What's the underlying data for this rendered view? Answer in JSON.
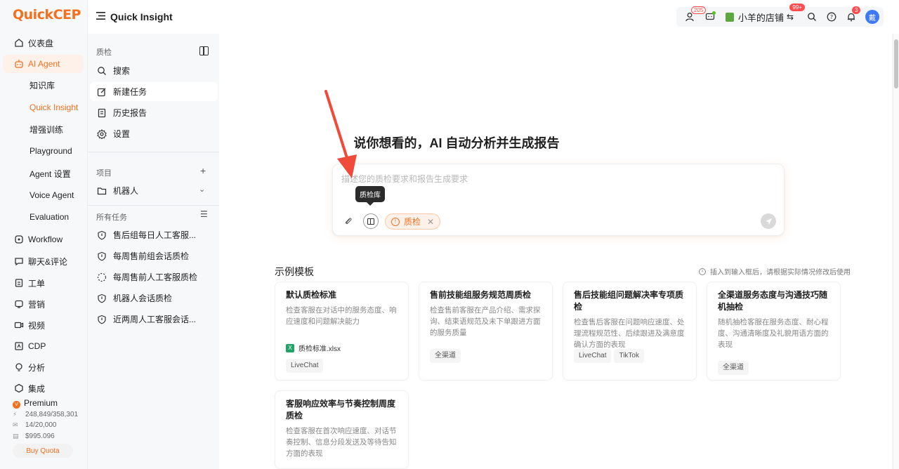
{
  "brand": {
    "logo_text": "QuickCEP",
    "accent": "#f2701f"
  },
  "nav": {
    "items": [
      {
        "label": "仪表盘",
        "icon": "home-icon"
      },
      {
        "label": "AI Agent",
        "icon": "robot-icon",
        "active": true
      },
      {
        "label": "Workflow",
        "icon": "workflow-icon"
      },
      {
        "label": "聊天&评论",
        "icon": "chat-icon"
      },
      {
        "label": "工单",
        "icon": "ticket-icon"
      },
      {
        "label": "营销",
        "icon": "marketing-icon"
      },
      {
        "label": "视频",
        "icon": "video-icon"
      },
      {
        "label": "CDP",
        "icon": "cdp-icon"
      },
      {
        "label": "分析",
        "icon": "analytics-icon"
      },
      {
        "label": "集成",
        "icon": "integration-icon"
      }
    ],
    "sub_items": [
      {
        "label": "知识库"
      },
      {
        "label": "Quick Insight",
        "active": true
      },
      {
        "label": "增强训练"
      },
      {
        "label": "Playground"
      },
      {
        "label": "Agent 设置"
      },
      {
        "label": "Voice Agent"
      },
      {
        "label": "Evaluation"
      }
    ],
    "plan": {
      "name": "Premium",
      "stat1": "248,849/358,301",
      "stat2": "14/20,000",
      "stat3": "$995.096",
      "quota_button": "Buy Quota"
    }
  },
  "header": {
    "title": "Quick Insight",
    "user_badge": "205",
    "store_name": "小羊的店铺",
    "store_badge": "99+",
    "bell_badge": "3",
    "avatar_text": "戴"
  },
  "panel": {
    "title": "质检",
    "items": [
      {
        "label": "搜索",
        "icon": "search-icon"
      },
      {
        "label": "新建任务",
        "icon": "edit-icon",
        "active": true
      },
      {
        "label": "历史报告",
        "icon": "report-icon"
      },
      {
        "label": "设置",
        "icon": "gear-icon"
      }
    ],
    "projects_label": "项目",
    "project": {
      "label": "机器人"
    },
    "tasks_label": "所有任务",
    "tasks": [
      {
        "label": "售后组每日人工客服..."
      },
      {
        "label": "每周售前组会话质检"
      },
      {
        "label": "每周售前人工客服质检"
      },
      {
        "label": "机器人会话质检"
      },
      {
        "label": "近两周人工客服会话..."
      }
    ]
  },
  "main": {
    "hero": "说你想看的，AI 自动分析并生成报告",
    "input_placeholder": "描述您的质检要求和报告生成要求",
    "tooltip": "质检库",
    "tag_label": "质检",
    "templates_title": "示例模板",
    "templates_hint": "插入到输入框后，请根据实际情况修改后使用",
    "cards": [
      {
        "title": "默认质检标准",
        "desc": "检查客服在对话中的服务态度、响应速度和问题解决能力",
        "file": "质检标准.xlsx",
        "chips": [
          "LiveChat"
        ]
      },
      {
        "title": "售前技能组服务规范周质检",
        "desc": "检查售前客服在产品介绍、需求探询、结束语规范及未下单跟进方面的服务质量",
        "chips": [
          "全渠道"
        ]
      },
      {
        "title": "售后技能组问题解决率专项质检",
        "desc": "检查售后客服在问题响应速度、处理流程规范性、后续跟进及满意度确认方面的表现",
        "chips": [
          "LiveChat",
          "TikTok"
        ]
      },
      {
        "title": "全渠道服务态度与沟通技巧随机抽检",
        "desc": "随机抽检客服在服务态度、耐心程度、沟通清晰度及礼貌用语方面的表现",
        "chips": [
          "全渠道"
        ]
      },
      {
        "title": "客服响应效率与节奏控制周度质检",
        "desc": "检查客服在首次响应速度、对话节奏控制、信息分段发送及等待告知方面的表现",
        "chips": []
      }
    ]
  }
}
